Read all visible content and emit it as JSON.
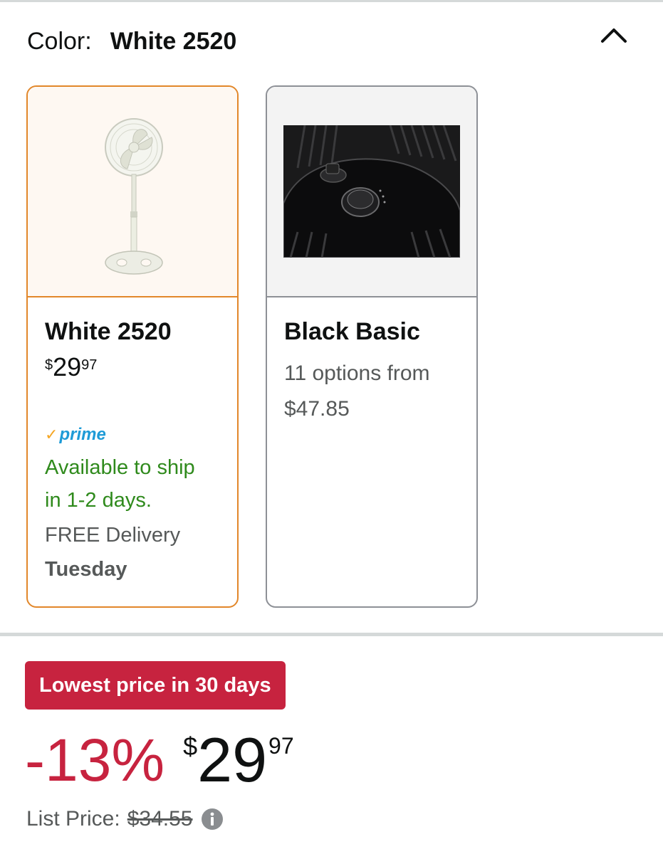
{
  "variation": {
    "label": "Color:",
    "selected": "White 2520"
  },
  "swatches": [
    {
      "title": "White 2520",
      "price": {
        "symbol": "$",
        "whole": "29",
        "fraction": "97"
      },
      "prime_label": "prime",
      "availability": [
        "Available to ship",
        "in 1-2 days."
      ],
      "delivery_text": "FREE Delivery",
      "delivery_day": "Tuesday"
    },
    {
      "title": "Black Basic",
      "options_line1": "11 options from",
      "options_line2": "$47.85"
    }
  ],
  "deal": {
    "badge": "Lowest price in 30 days",
    "discount": "-13%",
    "price": {
      "symbol": "$",
      "whole": "29",
      "fraction": "97"
    },
    "list_label": "List Price:",
    "list_price": "$34.55"
  },
  "colors": {
    "selected_border": "#e2872a",
    "deal_red": "#c7233f",
    "available_green": "#2f8a1c",
    "prime_blue": "#1e9bd7"
  },
  "icons": [
    "chevron-up-icon",
    "prime-check-icon",
    "info-icon"
  ]
}
